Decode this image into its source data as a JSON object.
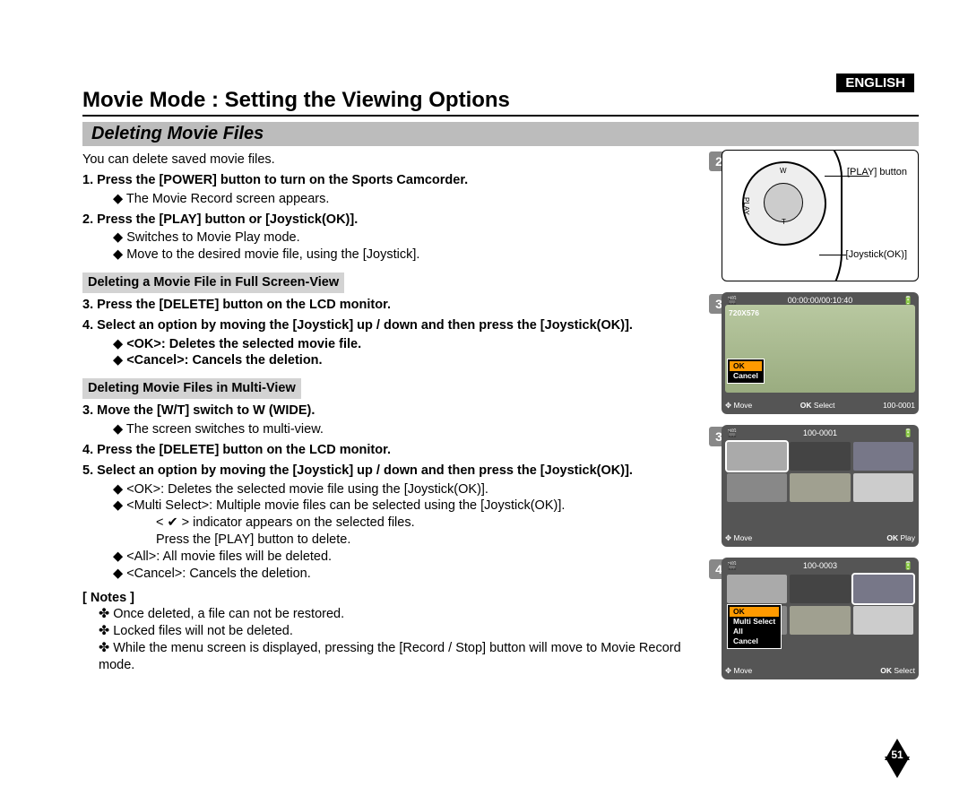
{
  "lang": "ENGLISH",
  "title": "Movie Mode : Setting the Viewing Options",
  "subtitle": "Deleting Movie Files",
  "intro": "You can delete saved movie files.",
  "step1": "Press the [POWER] button to turn on the Sports Camcorder.",
  "step1_sub1": "The Movie Record screen appears.",
  "step2": "Press the [PLAY] button or [Joystick(OK)].",
  "step2_sub1": "Switches to Movie Play mode.",
  "step2_sub2": "Move to the desired movie file, using the [Joystick].",
  "sec_a": "Deleting a Movie File in Full Screen-View",
  "a3": "Press the [DELETE] button on the LCD monitor.",
  "a4": "Select an option by moving the [Joystick] up / down and then press the [Joystick(OK)].",
  "a4_sub1": "<OK>: Deletes the selected movie file.",
  "a4_sub2": "<Cancel>: Cancels the deletion.",
  "sec_b": "Deleting Movie Files in Multi-View",
  "b3": "Move the [W/T] switch to W (WIDE).",
  "b3_sub1": "The screen switches to multi-view.",
  "b4": "Press the [DELETE] button on the LCD monitor.",
  "b5": "Select an option by moving the [Joystick] up / down and then press the [Joystick(OK)].",
  "b5_sub1": "<OK>: Deletes the selected movie file using the [Joystick(OK)].",
  "b5_sub2": "<Multi Select>: Multiple movie files can be selected using the [Joystick(OK)].",
  "b5_sub2b": "< ✔ > indicator appears on the selected files.",
  "b5_sub2c": "Press the [PLAY] button to delete.",
  "b5_sub3": "<All>: All movie files will be deleted.",
  "b5_sub4": "<Cancel>: Cancels the deletion.",
  "notes_hdr": "[ Notes ]",
  "n1": "Once deleted, a file can not be restored.",
  "n2": "Locked files will not be deleted.",
  "n3": "While the menu screen is displayed, pressing the [Record / Stop] button will move to Movie Record mode.",
  "fig2": {
    "num": "2",
    "play_btn": "[PLAY]\nbutton",
    "joy": "[Joystick(OK)]",
    "w": "W",
    "t": "T",
    "play": "PLAY"
  },
  "fig3a": {
    "num": "3",
    "time": "00:00:00/00:10:40",
    "res": "720X576",
    "ok": "OK",
    "cancel": "Cancel",
    "move": "Move",
    "select": "Select",
    "file": "100-0001"
  },
  "fig3b": {
    "num": "3",
    "file": "100-0001",
    "move": "Move",
    "play": "Play"
  },
  "fig4": {
    "num": "4",
    "file": "100-0003",
    "ok": "OK",
    "ms": "Multi Select",
    "all": "All",
    "cancel": "Cancel",
    "move": "Move",
    "select": "Select"
  },
  "page_num": "51",
  "ok_prefix": "OK"
}
